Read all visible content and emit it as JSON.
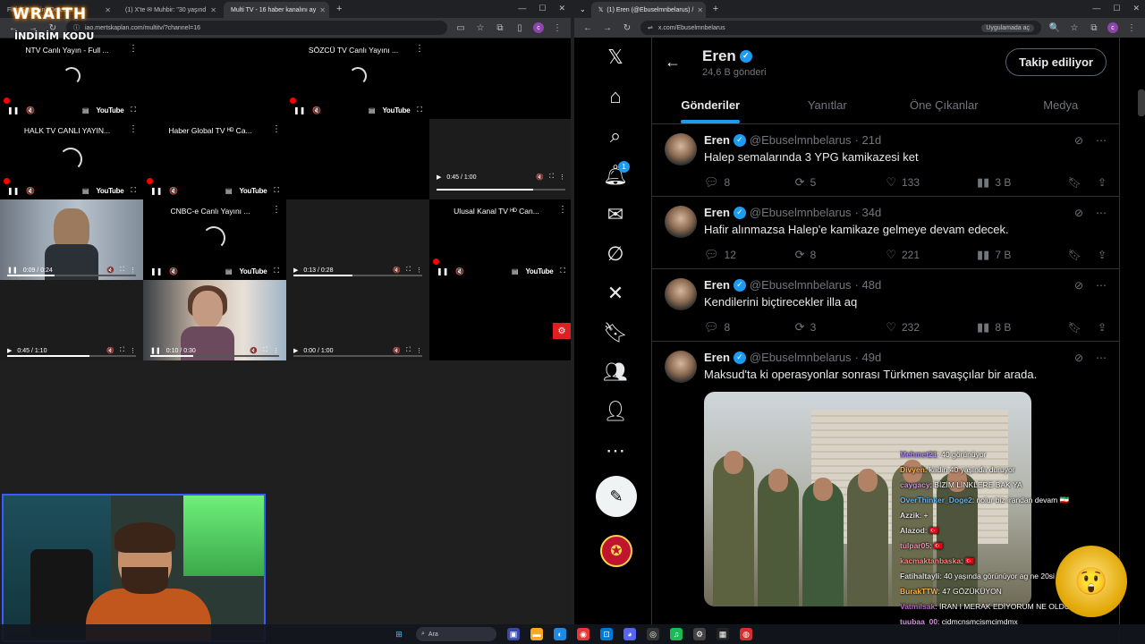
{
  "left_browser": {
    "tabs": [
      {
        "label": "FluidSight Link Detector"
      },
      {
        "label": "(1) X'te ✉ Muhbir: \"30 yaşınd"
      },
      {
        "label": "Multi TV - 16 haber kanalını ay"
      }
    ],
    "new_tab": "+",
    "url": "iao.mertskaplan.com/multitv/?channel=16"
  },
  "overlay": {
    "brand": "WRAITH",
    "code_label": "İNDİRİM KODU"
  },
  "multitv": {
    "youtube_label": "YouTube",
    "cells": [
      {
        "title": "NTV Canlı Yayın - Full ..."
      },
      {
        "title": "SÖZCÜ TV Canlı Yayını ..."
      },
      {
        "title": "HALK TV CANLI YAYIN..."
      },
      {
        "title": "Haber Global TV ᴴᴰ Ca..."
      },
      {
        "title": "CNBC-e Canlı Yayını ..."
      },
      {
        "title": "Ulusal Kanal TV ᴴᴰ Can..."
      }
    ],
    "times": [
      {
        "time": "0:45 / 1:00"
      },
      {
        "time": "0:09 / 0:24"
      },
      {
        "time": "0:13 / 0:28"
      },
      {
        "time": "0:45 / 1:10"
      },
      {
        "time": "0:10 / 0:30"
      },
      {
        "time": "0:00 / 1:00"
      }
    ]
  },
  "right_browser": {
    "tab": "(1) Eren (@Ebuselmnbelarus) /",
    "url": "x.com/Ebuselmnbelarus",
    "app_chip": "Uygulamada aç"
  },
  "x_profile": {
    "name": "Eren",
    "post_count": "24,6 B gönderi",
    "follow_label": "Takip ediliyor",
    "tabs": [
      {
        "label": "Gönderiler"
      },
      {
        "label": "Yanıtlar"
      },
      {
        "label": "Öne Çıkanlar"
      },
      {
        "label": "Medya"
      }
    ],
    "notification_count": "1",
    "tweets": [
      {
        "name": "Eren",
        "handle": "@Ebuselmnbelarus",
        "age": "· 21d",
        "text": "Halep semalarında 3 YPG kamikazesi ket",
        "replies": "8",
        "reposts": "5",
        "likes": "133",
        "views": "3 B"
      },
      {
        "name": "Eren",
        "handle": "@Ebuselmnbelarus",
        "age": "· 34d",
        "text": "Hafir alınmazsa Halep'e kamikaze gelmeye devam edecek.",
        "replies": "12",
        "reposts": "8",
        "likes": "221",
        "views": "7 B"
      },
      {
        "name": "Eren",
        "handle": "@Ebuselmnbelarus",
        "age": "· 48d",
        "text": "Kendilerini biçtirecekler illa aq",
        "replies": "8",
        "reposts": "3",
        "likes": "232",
        "views": "8 B"
      },
      {
        "name": "Eren",
        "handle": "@Ebuselmnbelarus",
        "age": "· 49d",
        "text": "Maksud'ta ki operasyonlar sonrası Türkmen savaşçılar bir arada."
      }
    ]
  },
  "chat": [
    {
      "user": "Mehmet21",
      "msg": ": 40 görünüyor",
      "color": "#b388ff"
    },
    {
      "user": "Divyen",
      "msg": ": kadın 40 yaşında duruyor",
      "color": "#ffb74d"
    },
    {
      "user": "caygacy",
      "msg": ": BİZİM LİNKLERE BAK YA",
      "color": "#ce93d8"
    },
    {
      "user": "OverThinker_Doge2",
      "msg": ": nolur biz irandan devam 🇮🇷",
      "color": "#64b5f6"
    },
    {
      "user": "Azzik",
      "msg": ": +",
      "color": "#e0e0e0"
    },
    {
      "user": "Alazod",
      "msg": ": 🇹🇷",
      "color": "#e0e0e0"
    },
    {
      "user": "tulpar05",
      "msg": ": 🇹🇷",
      "color": "#f48fb1"
    },
    {
      "user": "kacmaktanbaska",
      "msg": ": 🇹🇷",
      "color": "#ff8a80"
    },
    {
      "user": "Fatihaltayli",
      "msg": ": 40 yaşında görünüyor ag ne 20si",
      "color": "#e0e0e0"
    },
    {
      "user": "BurakTTW",
      "msg": ": 47 GÖZÜKÜYON",
      "color": "#ffb74d"
    },
    {
      "user": "Vatmilsak",
      "msg": ": İRAN I MERAK EDİYORUM NE OLDU YAKINA",
      "color": "#ba68c8"
    },
    {
      "user": "tuubaa_00",
      "msg": ": cjdmcnsmcjsmcjmdmx",
      "color": "#ce93d8"
    }
  ],
  "taskbar": {
    "search_placeholder": "Ara"
  }
}
